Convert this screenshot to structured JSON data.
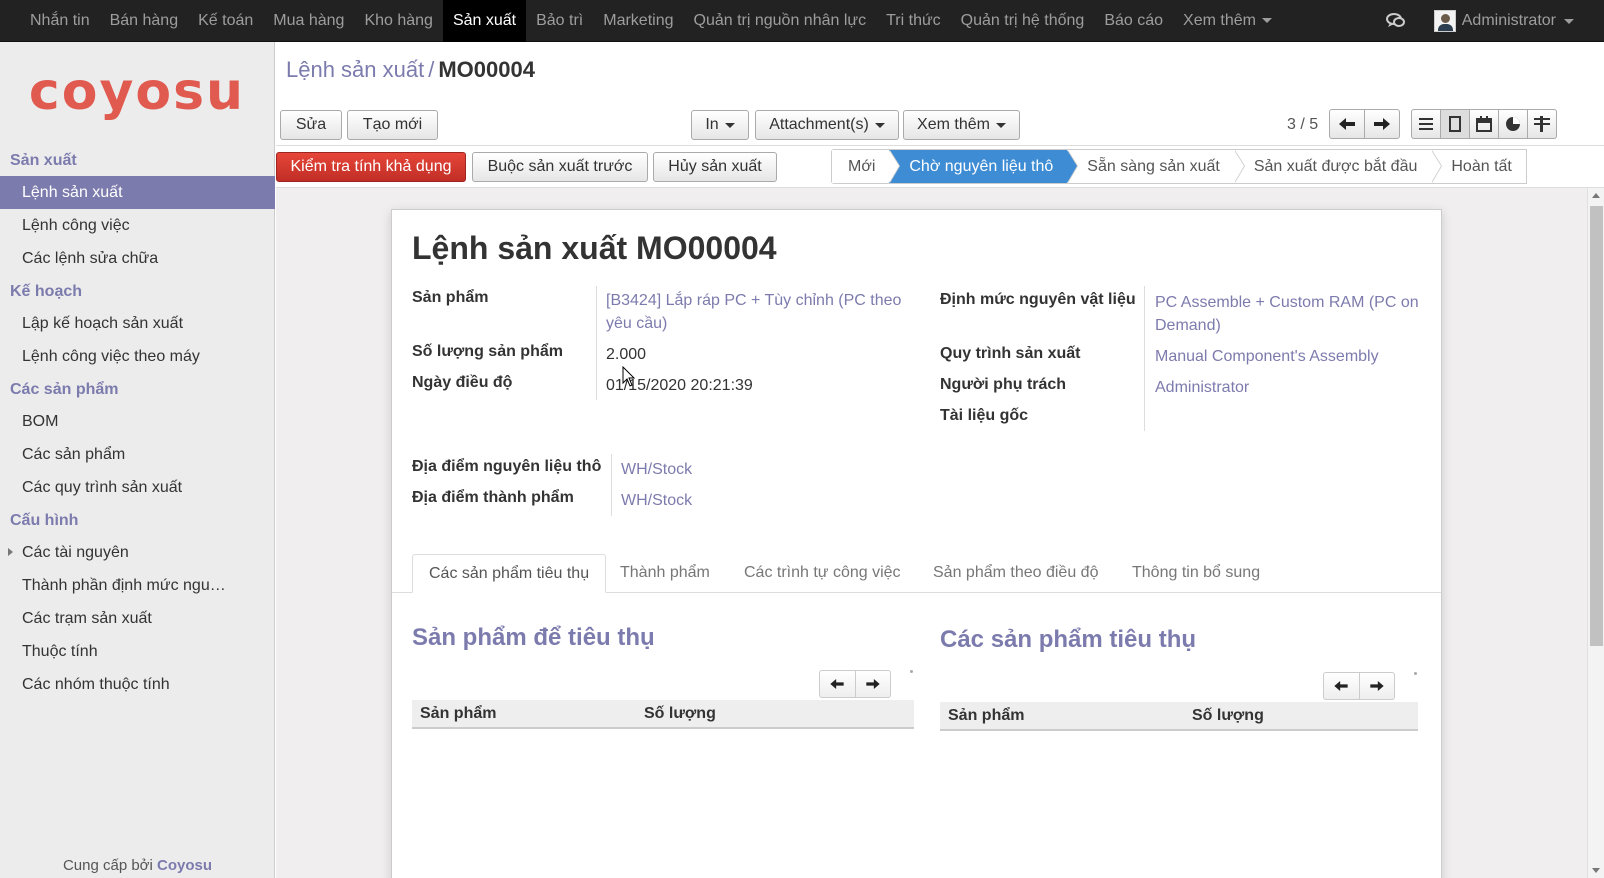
{
  "topnav": {
    "items": [
      "Nhắn tin",
      "Bán hàng",
      "Kế toán",
      "Mua hàng",
      "Kho hàng",
      "Sản xuất",
      "Bảo trì",
      "Marketing",
      "Quản trị nguồn nhân lực",
      "Tri thức",
      "Quản trị hệ thống",
      "Báo cáo",
      "Xem thêm"
    ],
    "active_index": 5,
    "user": "Administrator"
  },
  "sidebar": {
    "logo": "coyosu",
    "sections": [
      {
        "title": "Sản xuất",
        "items": [
          "Lệnh sản xuất",
          "Lệnh công việc",
          "Các lệnh sửa chữa"
        ]
      },
      {
        "title": "Kế hoạch",
        "items": [
          "Lập kế hoạch sản xuất",
          "Lệnh công việc theo máy"
        ]
      },
      {
        "title": "Các sản phẩm",
        "items": [
          "BOM",
          "Các sản phẩm",
          "Các quy trình sản xuất"
        ]
      },
      {
        "title": "Cấu hình",
        "items": [
          "Các tài nguyên",
          "Thành phần định mức ngu…",
          "Các trạm sản xuất",
          "Thuộc tính",
          "Các nhóm thuộc tính"
        ]
      }
    ],
    "footer_prefix": "Cung cấp bởi",
    "footer_brand": "Coyosu"
  },
  "breadcrumb": {
    "parent": "Lệnh sản xuất",
    "separator": "/",
    "current": "MO00004"
  },
  "toolbar": {
    "edit": "Sửa",
    "create": "Tạo mới",
    "print": "In",
    "attachments": "Attachment(s)",
    "more": "Xem thêm",
    "pager": "3 / 5"
  },
  "statusbar": {
    "check_availability": "Kiểm tra tính khả dụng",
    "force_produce": "Buộc sản xuất trước",
    "cancel": "Hủy sản xuất",
    "stages": [
      "Mới",
      "Chờ nguyên liệu thô",
      "Sẵn sàng sản xuất",
      "Sản xuất được bắt đầu",
      "Hoàn tất"
    ],
    "active_stage": 1
  },
  "form": {
    "title": "Lệnh sản xuất MO00004",
    "product_label": "Sản phẩm",
    "product_value": "[B3424] Lắp ráp PC + Tùy chỉnh (PC theo yêu cầu)",
    "qty_label": "Số lượng sản phẩm",
    "qty_value": "2.000",
    "date_label": "Ngày điều độ",
    "date_value": "01/15/2020 20:21:39",
    "bom_label": "Định mức nguyên vật liệu",
    "bom_value": "PC Assemble + Custom RAM (PC on Demand)",
    "routing_label": "Quy trình sản xuất",
    "routing_value": "Manual Component's Assembly",
    "responsible_label": "Người phụ trách",
    "responsible_value": "Administrator",
    "origin_label": "Tài liệu gốc",
    "src_loc_label": "Địa điểm nguyên liệu thô",
    "src_loc_value": "WH/Stock",
    "dest_loc_label": "Địa điểm thành phẩm",
    "dest_loc_value": "WH/Stock"
  },
  "tabs": [
    "Các sản phẩm tiêu thụ",
    "Thành phẩm",
    "Các trình tự công việc",
    "Sản phẩm theo điều độ",
    "Thông tin bổ sung"
  ],
  "consumed": {
    "left_title": "Sản phẩm để tiêu thụ",
    "right_title": "Các sản phẩm tiêu thụ",
    "col_product": "Sản phẩm",
    "col_qty": "Số lượng"
  },
  "colors": {
    "accent": "#7c7bad",
    "primary_btn": "#d9362c",
    "active_stage": "#3d8cd4",
    "topbar": "#222222",
    "logo": "#e05a4f"
  }
}
